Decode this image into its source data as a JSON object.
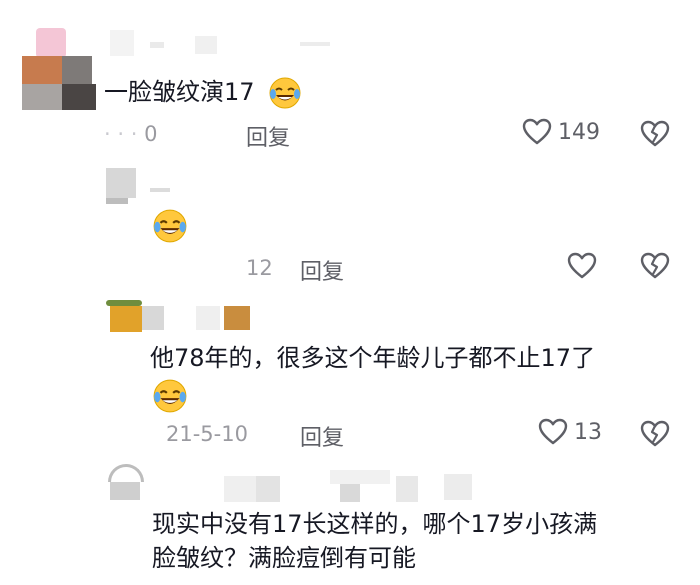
{
  "comments": [
    {
      "text": "一脸皱纹演17",
      "date": "0",
      "reply_label": "回复",
      "likes": "149",
      "emoji": "laughing-crying-emoji"
    },
    {
      "text": "",
      "date": "12",
      "reply_label": "回复",
      "likes": "",
      "emoji": "laughing-crying-emoji"
    },
    {
      "text": "他78年的，很多这个年龄儿子都不止17了",
      "date": "21-5-10",
      "reply_label": "回复",
      "likes": "13",
      "emoji": "laughing-crying-emoji"
    },
    {
      "text_line1": "现实中没有17长这样的，哪个17岁小孩满",
      "text_line2": "脸皱纹？满脸痘倒有可能"
    }
  ],
  "icons": {
    "like": "heart-outline-icon",
    "dislike": "broken-heart-icon"
  },
  "colors": {
    "text": "#161823",
    "meta": "#9a9aa0",
    "icon": "#5e5f66"
  }
}
